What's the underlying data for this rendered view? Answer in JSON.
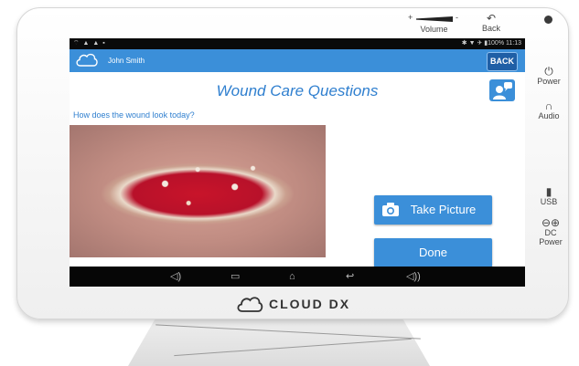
{
  "hardware": {
    "volume_label": "Volume",
    "volume_plus": "+",
    "volume_minus": "-",
    "back_label": "Back",
    "power_label": "Power",
    "audio_label": "Audio",
    "usb_label": "USB",
    "dc_power_label": "DC\nPower"
  },
  "statusbar": {
    "left_icons": "⌔ ▲ ▲ ▪",
    "right_text": "✱ ▼ ✈ ▮100% 11:13"
  },
  "appbar": {
    "user_name": "John Smith",
    "back_button": "BACK"
  },
  "content": {
    "title": "Wound Care Questions",
    "question": "How does the wound look today?",
    "take_picture_button": "Take Picture",
    "done_button": "Done"
  },
  "navbar": {
    "icons": [
      "volume-down-icon",
      "recent-apps-icon",
      "home-icon",
      "back-icon",
      "volume-up-icon"
    ]
  },
  "brand": {
    "text": "CLOUD DX"
  },
  "colors": {
    "accent": "#3b8fd9",
    "back_button": "#1f5fa6",
    "title": "#2f7fcf"
  }
}
